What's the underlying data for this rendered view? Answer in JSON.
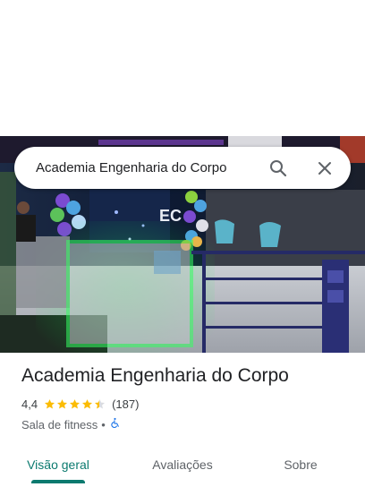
{
  "search": {
    "query": "Academia Engenharia do Corpo",
    "search_icon": "search-icon",
    "close_icon": "close-icon"
  },
  "photo": {
    "logo_text": "EC",
    "description_icon": "gym-interior-photo"
  },
  "place": {
    "name": "Academia Engenharia do Corpo",
    "rating": "4,4",
    "rating_value": 4.4,
    "review_count": "(187)",
    "category": "Sala de fitness",
    "separator": "•",
    "accessibility_icon": "wheelchair-icon"
  },
  "tabs": [
    {
      "label": "Visão geral",
      "active": true
    },
    {
      "label": "Avaliações",
      "active": false
    },
    {
      "label": "Sobre",
      "active": false
    }
  ],
  "colors": {
    "accent": "#0b7a6f",
    "star": "#fbbc04",
    "accessibility": "#1a73e8"
  }
}
